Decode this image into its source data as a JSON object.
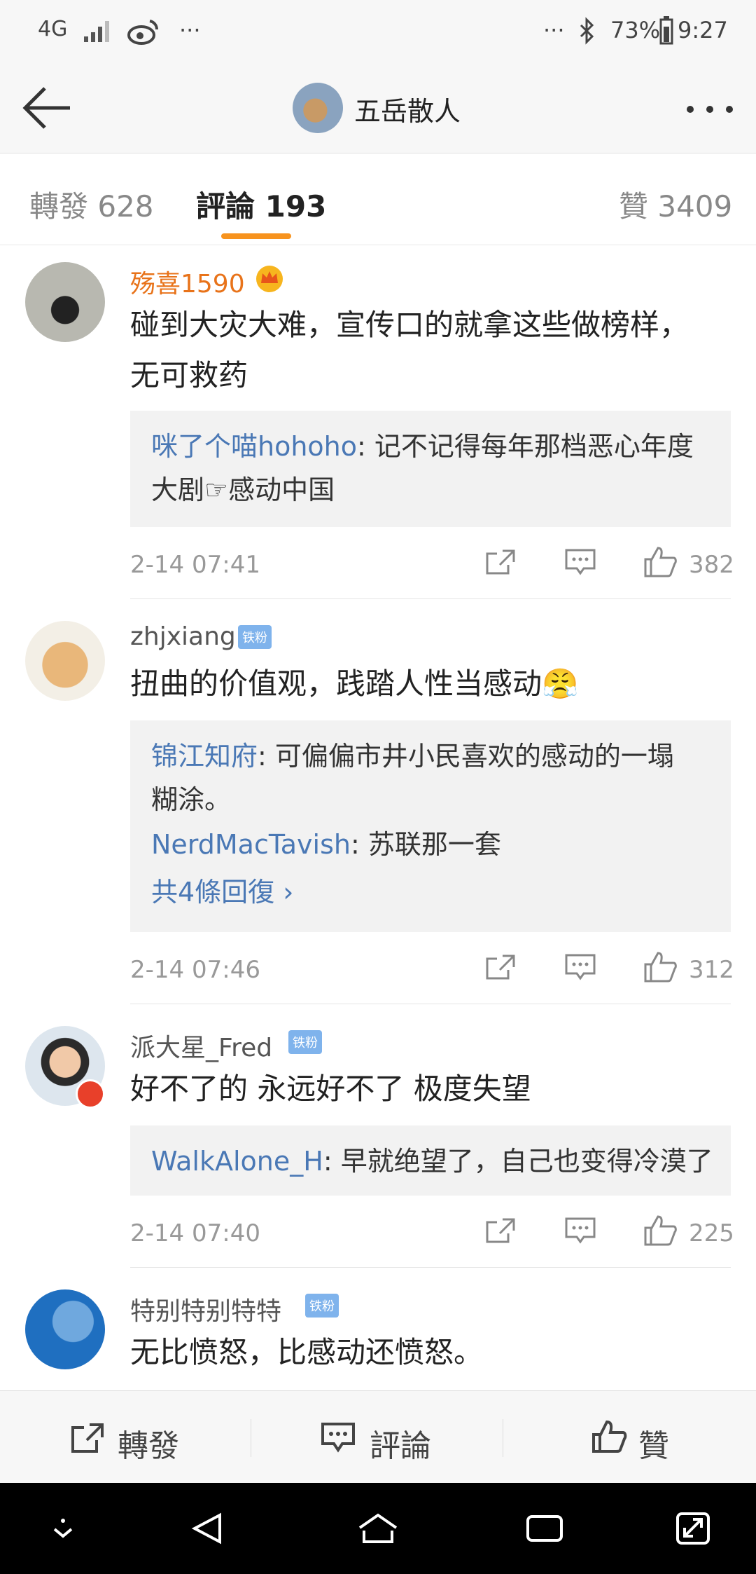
{
  "status_bar": {
    "network": "4G",
    "time": "9:27",
    "battery": "73%",
    "ellipsis_left": "···",
    "ellipsis_right": "···"
  },
  "header": {
    "title": "五岳散人",
    "back_icon": "arrow-left-icon",
    "more_icon": "more-dots-icon"
  },
  "tabs": [
    {
      "label": "轉發 628"
    },
    {
      "label": "評論 193"
    },
    {
      "label": "贊 3409"
    }
  ],
  "comments": [
    {
      "user": "殇喜1590",
      "text_line1": "碰到大灾大难，宣传口的就拿这些做榜样，",
      "text_line2": "无可救药",
      "replies": [
        {
          "name": "咪了个喵hohoho",
          "text": ": 记不记得每年那档恶心年度",
          "text2": "大剧☞感动中国"
        }
      ],
      "time": "2-14 07:41",
      "likes": "382"
    },
    {
      "user": "zhjxiang",
      "badge": "铁粉",
      "text_line1": "扭曲的价值观，践踏人性当感动😤",
      "replies": [
        {
          "name": "锦江知府",
          "text": ": 可偏偏市井小民喜欢的感动的一塌",
          "text2": "糊涂。"
        },
        {
          "name": "NerdMacTavish",
          "text": ": 苏联那一套"
        }
      ],
      "more_replies": "共4條回復 ›",
      "time": "2-14 07:46",
      "likes": "312"
    },
    {
      "user": "派大星_Fred",
      "badge": "铁粉",
      "text_line1": "好不了的 永远好不了 极度失望",
      "replies": [
        {
          "name": "WalkAlone_H",
          "text": ": 早就绝望了，自己也变得冷漠了"
        }
      ],
      "time": "2-14 07:40",
      "likes": "225"
    },
    {
      "user": "特别特别特特",
      "badge": "铁粉",
      "text_line1": "无比愤怒，比感动还愤怒。"
    }
  ],
  "action_bar": {
    "repost": "轉發",
    "comment": "評論",
    "like": "贊"
  },
  "colors": {
    "accent": "#f7931e",
    "link": "#4a78b5",
    "vip_name": "#e8731a"
  }
}
